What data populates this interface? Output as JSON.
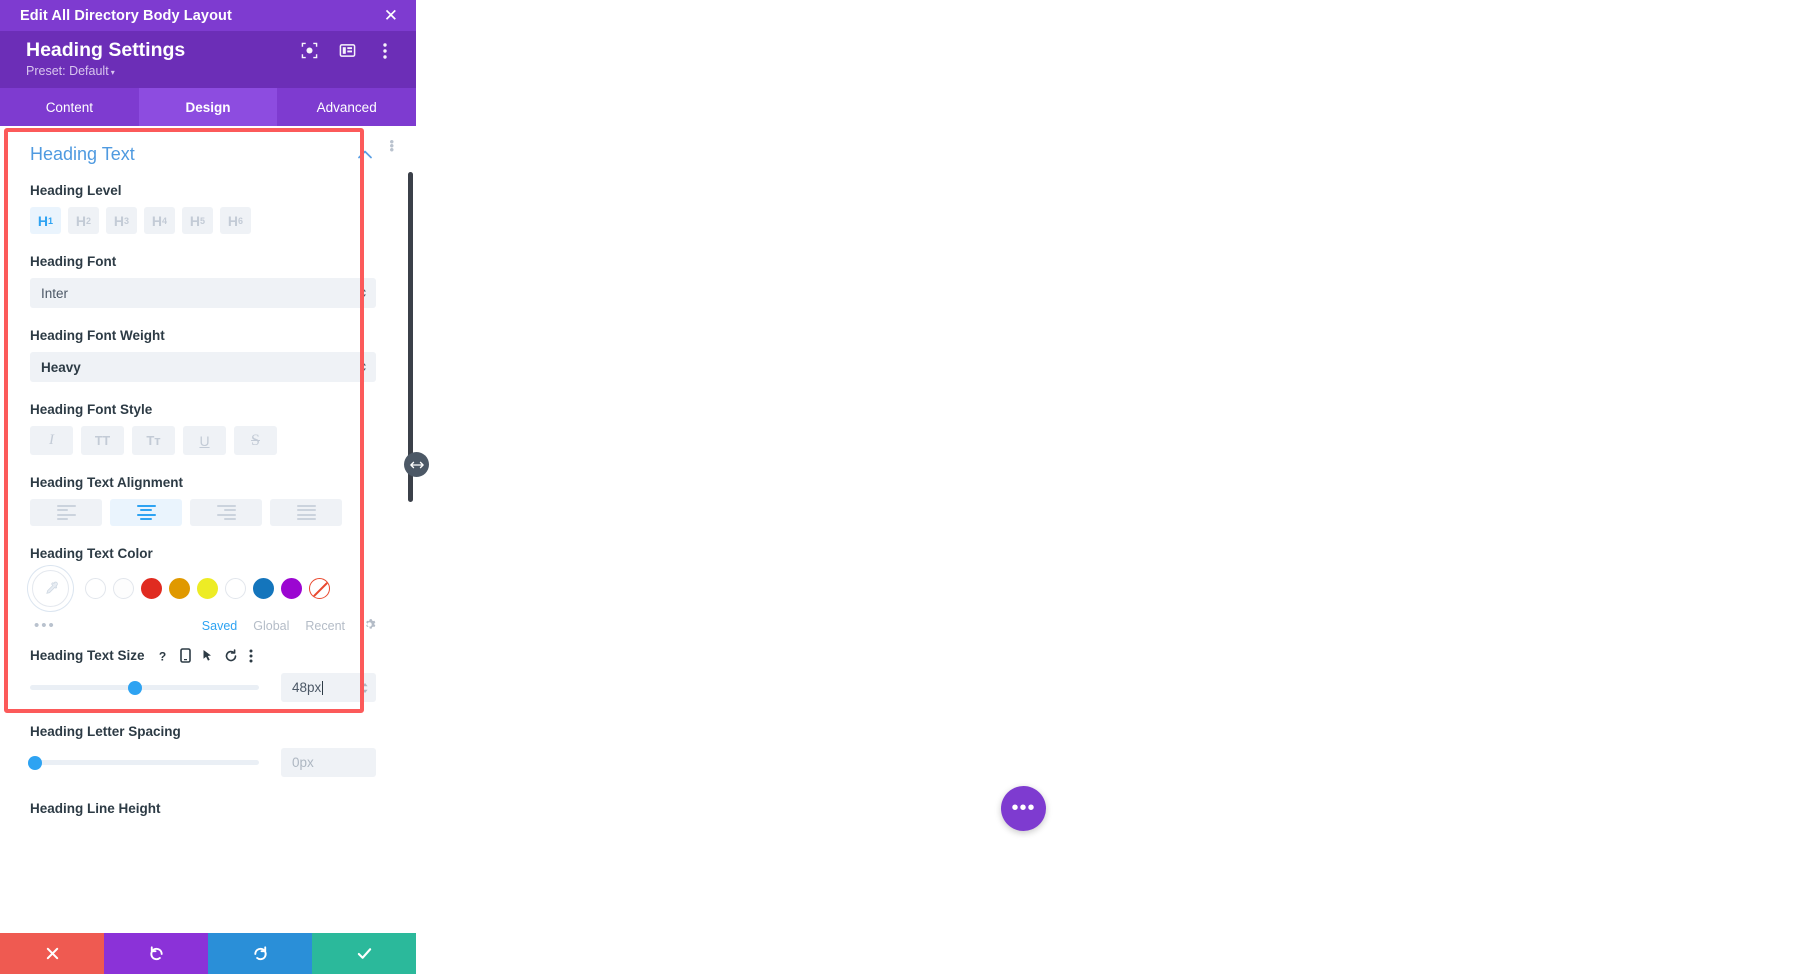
{
  "window": {
    "layout_title": "Edit All Directory Body Layout",
    "close_label": "✕"
  },
  "module": {
    "title": "Heading Settings",
    "preset_label": "Preset: Default",
    "preset_caret": "▾",
    "icons": [
      "target-frame-icon",
      "panel-layout-icon",
      "vertical-dots-icon"
    ]
  },
  "tabs": [
    {
      "label": "Content",
      "active": false
    },
    {
      "label": "Design",
      "active": true
    },
    {
      "label": "Advanced",
      "active": false
    }
  ],
  "section": {
    "title": "Heading Text",
    "collapse_icon": "chevron-up-icon",
    "options_icon": "vertical-dots-icon"
  },
  "heading_level": {
    "label": "Heading Level",
    "options": [
      {
        "tag": "H",
        "num": "1",
        "active": true
      },
      {
        "tag": "H",
        "num": "2",
        "active": false
      },
      {
        "tag": "H",
        "num": "3",
        "active": false
      },
      {
        "tag": "H",
        "num": "4",
        "active": false
      },
      {
        "tag": "H",
        "num": "5",
        "active": false
      },
      {
        "tag": "H",
        "num": "6",
        "active": false
      }
    ]
  },
  "heading_font": {
    "label": "Heading Font",
    "value": "Inter"
  },
  "heading_font_weight": {
    "label": "Heading Font Weight",
    "value": "Heavy"
  },
  "heading_font_style": {
    "label": "Heading Font Style",
    "options": [
      {
        "name": "italic",
        "glyph": "I"
      },
      {
        "name": "uppercase",
        "glyph": "TT"
      },
      {
        "name": "small-caps",
        "glyph": "Tᴛ"
      },
      {
        "name": "underline",
        "glyph": "U"
      },
      {
        "name": "strikethrough",
        "glyph": "S"
      }
    ]
  },
  "heading_alignment": {
    "label": "Heading Text Alignment",
    "options": [
      {
        "name": "align-left",
        "active": false
      },
      {
        "name": "align-center",
        "active": true
      },
      {
        "name": "align-right",
        "active": false
      },
      {
        "name": "align-justify",
        "active": false
      }
    ]
  },
  "heading_color": {
    "label": "Heading Text Color",
    "picker_icon": "eyedropper-icon",
    "swatches": [
      {
        "name": "white-1",
        "color": "#ffffff"
      },
      {
        "name": "white-2",
        "color": "#fdfdfd"
      },
      {
        "name": "red",
        "color": "#e02b20"
      },
      {
        "name": "orange",
        "color": "#e09900"
      },
      {
        "name": "yellow",
        "color": "#edec25"
      },
      {
        "name": "white-3",
        "color": "#ffffff"
      },
      {
        "name": "blue",
        "color": "#1475bc"
      },
      {
        "name": "purple",
        "color": "#9b06d1"
      },
      {
        "name": "none",
        "color": "transparent"
      }
    ],
    "more_dots": "•••",
    "tabs": [
      {
        "label": "Saved",
        "active": true
      },
      {
        "label": "Global",
        "active": false
      },
      {
        "label": "Recent",
        "active": false
      }
    ],
    "gear_icon": "gear-icon"
  },
  "heading_text_size": {
    "label": "Heading Text Size",
    "icons": [
      {
        "name": "help-icon",
        "glyph": "?"
      },
      {
        "name": "responsive-mobile-icon",
        "glyph": "▯"
      },
      {
        "name": "hover-cursor-icon",
        "glyph": "➤"
      },
      {
        "name": "reset-icon",
        "glyph": "↺"
      },
      {
        "name": "vertical-dots-icon",
        "glyph": "⋮"
      }
    ],
    "value": "48px",
    "slider_percent": 46
  },
  "heading_letter_spacing": {
    "label": "Heading Letter Spacing",
    "placeholder": "0px",
    "slider_percent": 2
  },
  "heading_line_height": {
    "label": "Heading Line Height"
  },
  "action_bar": [
    {
      "name": "cancel-button",
      "glyph": "✕",
      "color": "#ef5a51"
    },
    {
      "name": "undo-button",
      "glyph": "↺",
      "color": "#8b32d8"
    },
    {
      "name": "redo-button",
      "glyph": "↻",
      "color": "#2a8fd8"
    },
    {
      "name": "save-button",
      "glyph": "✓",
      "color": "#2bb99b"
    }
  ],
  "canvas": {
    "fab_label": "•••"
  },
  "drag_handle": {
    "glyph": "↔"
  }
}
